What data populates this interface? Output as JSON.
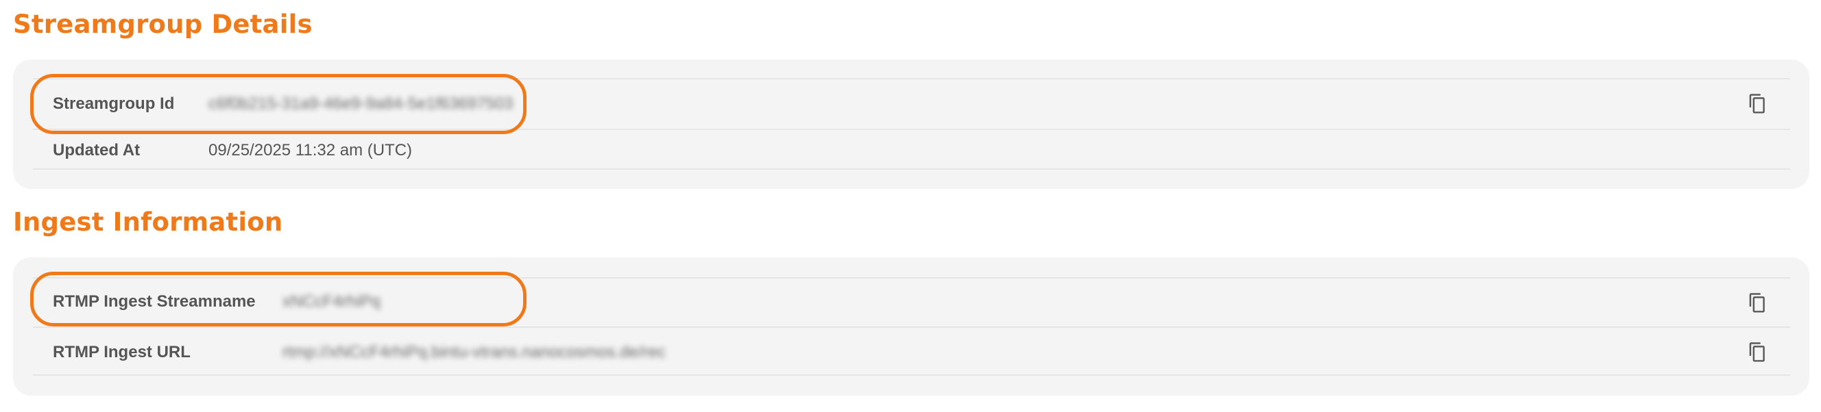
{
  "sections": [
    {
      "title": "Streamgroup Details",
      "rows": [
        {
          "label": "Streamgroup Id",
          "value": "c6f0b215-31a9-46e9-9a84-5e1f63697503",
          "copy_icon": "copy-icon"
        },
        {
          "label": "Updated At",
          "value": "09/25/2025 11:32 am (UTC)"
        }
      ]
    },
    {
      "title": "Ingest Information",
      "rows": [
        {
          "label": "RTMP Ingest Streamname",
          "value": "xNCcF4rhiPq",
          "copy_icon": "copy-icon"
        },
        {
          "label": "RTMP Ingest URL",
          "value": "rtmp://xNCcF4rhiPq.bintu-vtrans.nanocosmos.de/rec",
          "copy_icon": "copy-icon"
        }
      ]
    }
  ],
  "colors": {
    "accent": "#f07a1a",
    "panel_bg": "#f4f4f4",
    "text": "#555555",
    "divider": "#e6e6e6"
  }
}
